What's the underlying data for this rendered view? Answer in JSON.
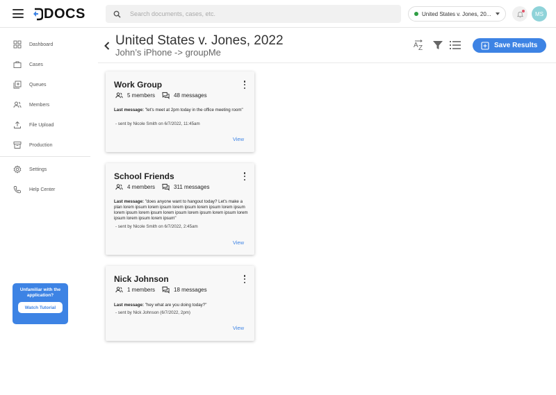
{
  "colors": {
    "accent": "#3d83e4",
    "status_green": "#2f9e44",
    "avatar_bg": "#8fd3d9",
    "notification_red": "#e0566a"
  },
  "app": {
    "logo_text": "DOCS"
  },
  "search": {
    "placeholder": "Search documents, cases, etc."
  },
  "case_selector": {
    "value": "United States v. Jones, 20..."
  },
  "user": {
    "initials": "MS"
  },
  "sidebar": {
    "items": [
      {
        "label": "Dashboard",
        "icon": "dashboard-icon"
      },
      {
        "label": "Cases",
        "icon": "briefcase-icon"
      },
      {
        "label": "Queues",
        "icon": "queue-icon"
      },
      {
        "label": "Members",
        "icon": "members-icon"
      },
      {
        "label": "File Upload",
        "icon": "upload-icon"
      },
      {
        "label": "Production",
        "icon": "archive-icon"
      },
      {
        "label": "Settings",
        "icon": "gear-icon"
      },
      {
        "label": "Help Center",
        "icon": "phone-icon"
      }
    ],
    "tutorial": {
      "text": "Unfamiliar with the application?",
      "button": "Watch Tutorial"
    }
  },
  "header": {
    "title": "United States v. Jones, 2022",
    "subtitle": "John’s iPhone -> groupMe",
    "save_label": "Save Results"
  },
  "cards": [
    {
      "title": "Work Group",
      "members": "5 members",
      "messages": "48 messages",
      "last_label": "Last message:",
      "last_message": "\"let's meet at 2pm today in the office meeting room\"",
      "sent_by": "- sent by Nicole Smith on 6/7/2022, 11:45am",
      "view": "View"
    },
    {
      "title": "School Friends",
      "members": "4 members",
      "messages": "311 messages",
      "last_label": "Last message:",
      "last_message": "\"does anyone want to hangout today? Let's make a plan lorem ipsum lorem ipsum lorem ipsum lorem ipsum lorem ipsum lorem ipsum lorem ipsum lorem ipsum lorem ipsum lorem ipsum lorem ipsum lorem ipsum lorem ipsum\"",
      "sent_by": "- sent by Nicole Smith on 6/7/2022, 2:45am",
      "view": "View"
    },
    {
      "title": "Nick Johnson",
      "members": "1 members",
      "messages": "18 messages",
      "last_label": "Last message:",
      "last_message": "\"hey what are you doing today?\"",
      "sent_by": "- sent by Nick Johnson (6/7/2022, 2pm)",
      "view": "View"
    }
  ]
}
